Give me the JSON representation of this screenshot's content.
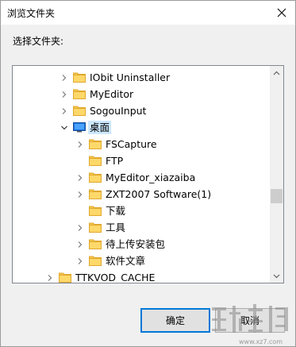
{
  "window": {
    "title": "浏览文件夹"
  },
  "instruction": "选择文件夹:",
  "tree": {
    "items": [
      {
        "label": "IObit Uninstaller",
        "level": 1,
        "expanded": false,
        "selected": false
      },
      {
        "label": "MyEditor",
        "level": 1,
        "expanded": false,
        "selected": false
      },
      {
        "label": "SogouInput",
        "level": 1,
        "expanded": false,
        "selected": false
      },
      {
        "label": "桌面",
        "level": 1,
        "expanded": true,
        "selected": true
      },
      {
        "label": "FSCapture",
        "level": 2,
        "expanded": false,
        "selected": false
      },
      {
        "label": "FTP",
        "level": 2,
        "expanded": null,
        "selected": false
      },
      {
        "label": "MyEditor_xiazaiba",
        "level": 2,
        "expanded": false,
        "selected": false
      },
      {
        "label": "ZXT2007 Software(1)",
        "level": 2,
        "expanded": false,
        "selected": false
      },
      {
        "label": "下载",
        "level": 2,
        "expanded": null,
        "selected": false
      },
      {
        "label": "工具",
        "level": 2,
        "expanded": false,
        "selected": false
      },
      {
        "label": "待上传安装包",
        "level": 2,
        "expanded": false,
        "selected": false
      },
      {
        "label": "软件文章",
        "level": 2,
        "expanded": false,
        "selected": false
      },
      {
        "label": "TTKVOD_CACHE",
        "level": 0,
        "expanded": false,
        "selected": false
      }
    ]
  },
  "buttons": {
    "ok": "确定",
    "cancel": "取消"
  },
  "watermark": {
    "text": "www.xz7.com"
  },
  "colors": {
    "folder": "#f5c74c",
    "folder_dark": "#e0a82e",
    "selected": "#cce8ff",
    "desktop_icon": "#1e6fd9",
    "accent": "#0078d7"
  }
}
